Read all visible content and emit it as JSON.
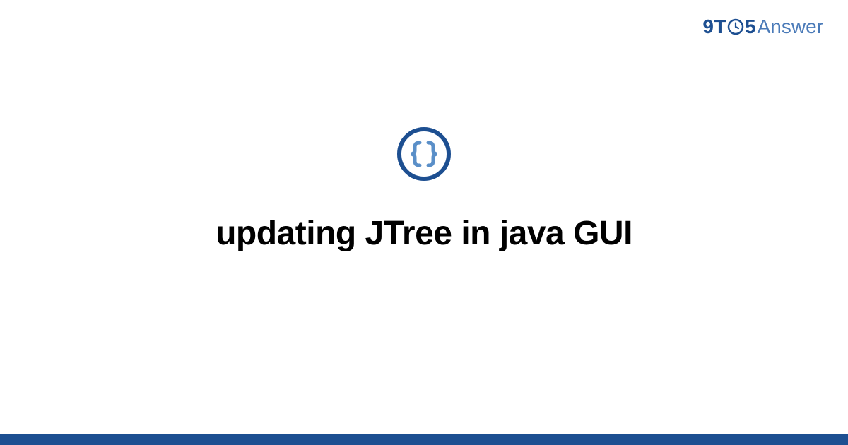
{
  "brand": {
    "part1": "9T",
    "part2": "5",
    "part3": "Answer"
  },
  "main": {
    "title": "updating JTree in java GUI"
  },
  "icons": {
    "braces": "braces-icon",
    "clock": "clock-o-icon"
  },
  "colors": {
    "brand_dark": "#1d4f91",
    "brand_light": "#4a7ab8",
    "accent": "#5a8fc8"
  }
}
